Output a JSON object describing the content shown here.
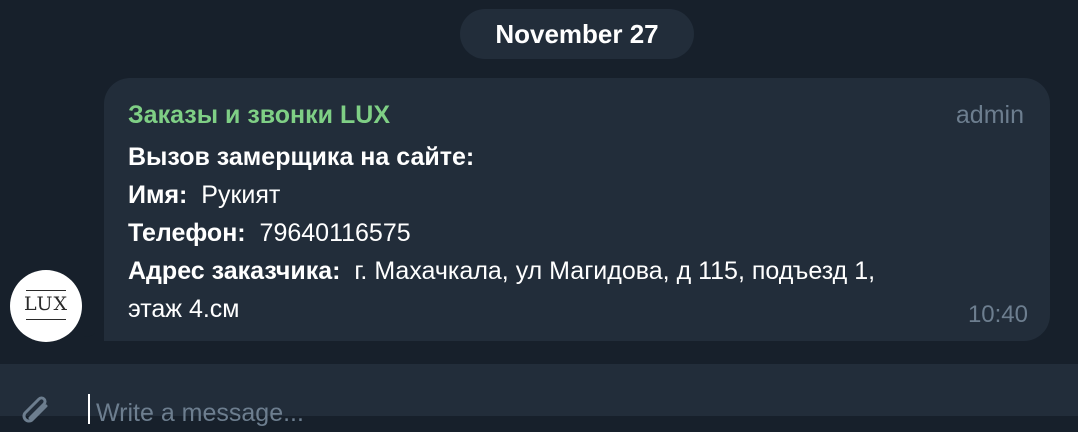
{
  "date_separator": "November 27",
  "avatar": {
    "logo_text": "LUX"
  },
  "message": {
    "sender": "Заказы и звонки LUX",
    "role": "admin",
    "title": "Вызов замерщика на сайте:",
    "fields": [
      {
        "label": "Имя:",
        "value": "Рукият"
      },
      {
        "label": "Телефон:",
        "value": "79640116575"
      },
      {
        "label": "Адрес заказчика:",
        "value": "г. Махачкала, ул Магидова, д 115, подъезд 1,"
      }
    ],
    "continuation": "этаж 4.см",
    "time": "10:40"
  },
  "composer": {
    "placeholder": "Write a message..."
  },
  "colors": {
    "background": "#17202b",
    "bubble": "#222d3a",
    "sender": "#7fcf85",
    "muted": "#6d7e8f",
    "text": "#ffffff"
  },
  "icons": {
    "attach": "paperclip-icon"
  }
}
